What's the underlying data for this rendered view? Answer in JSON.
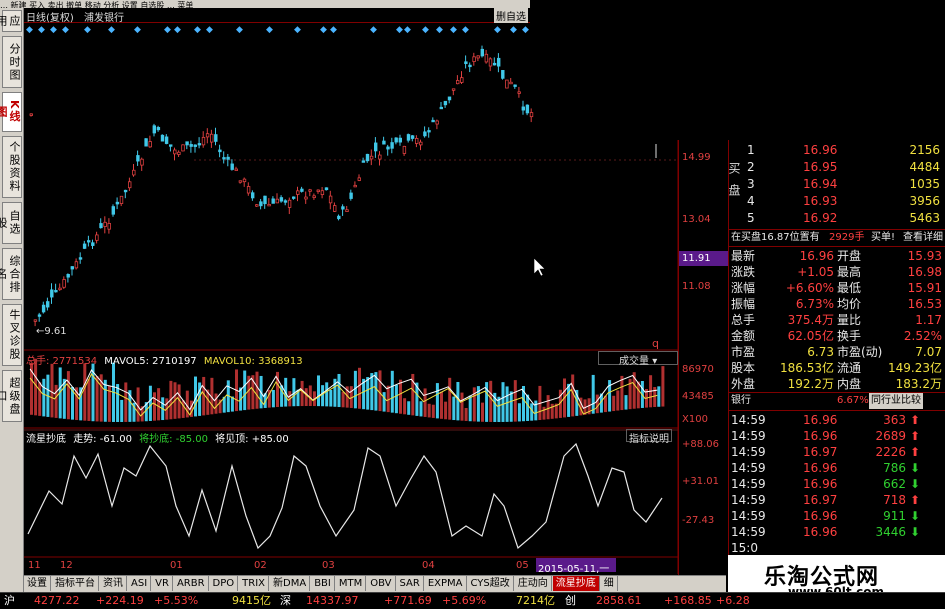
{
  "top_menu": {
    "text": "…  新建  买入  卖出  撤单  移动  分析  设置  自选股  …  菜单"
  },
  "left_tabs": [
    {
      "label": "应用",
      "active": false
    },
    {
      "label": "分时图",
      "active": false
    },
    {
      "label": "K线图",
      "active": true
    },
    {
      "label": "个股资料",
      "active": false
    },
    {
      "label": "自选股",
      "active": false
    },
    {
      "label": "综合排名",
      "active": false
    },
    {
      "label": "牛叉诊股",
      "active": false
    },
    {
      "label": "超级盘口",
      "active": false
    }
  ],
  "title": {
    "period": "日线(复权)",
    "stock": "浦发银行",
    "add_watch": "删自选"
  },
  "price_axis": {
    "labels": [
      "14.99",
      "13.04",
      "11.91",
      "11.08"
    ],
    "low_label": "9.61",
    "arrow_label": "q"
  },
  "volume_panel": {
    "total_label": "总手: 2771534",
    "ma5_label": "MAVOL5: 2710197",
    "ma10_label": "MAVOL10: 3368913",
    "selector": "成交量",
    "axis": [
      "86970",
      "43485",
      "X100"
    ]
  },
  "indicator_panel": {
    "name": "流星抄底",
    "trend": "走势: -61.00",
    "buy": "将抄底: -85.00",
    "sell": "将见顶: +85.00",
    "help": "指标说明",
    "axis": [
      "+88.06",
      "+31.01",
      "-27.43"
    ]
  },
  "date_axis": {
    "labels": [
      "11",
      "12",
      "01",
      "02",
      "03",
      "04",
      "05"
    ],
    "cursor_date": "2015-05-11,一"
  },
  "bottom_tabs": [
    "设置",
    "指标平台",
    "资讯",
    "ASI",
    "VR",
    "ARBR",
    "DPO",
    "TRIX",
    "新DMA",
    "BBI",
    "MTM",
    "OBV",
    "SAR",
    "EXPMA",
    "CYS超改",
    "庄动向",
    "流星抄底",
    "细"
  ],
  "bottom_active": "流星抄底",
  "order_book": {
    "sell_label": "买盘",
    "rows": [
      {
        "n": "1",
        "p": "16.96",
        "v": "2156"
      },
      {
        "n": "2",
        "p": "16.95",
        "v": "4484"
      },
      {
        "n": "3",
        "p": "16.94",
        "v": "1035"
      },
      {
        "n": "4",
        "p": "16.93",
        "v": "3956"
      },
      {
        "n": "5",
        "p": "16.92",
        "v": "5463"
      }
    ]
  },
  "order_info": {
    "text": "在买盘16.87位置有",
    "qty": "2929手",
    "action": "买单!",
    "detail": "查看详细"
  },
  "stats": [
    {
      "k1": "最新",
      "v1": "16.96",
      "k2": "开盘",
      "v2": "15.93"
    },
    {
      "k1": "涨跌",
      "v1": "+1.05",
      "k2": "最高",
      "v2": "16.98"
    },
    {
      "k1": "涨幅",
      "v1": "+6.60%",
      "k2": "最低",
      "v2": "15.91"
    },
    {
      "k1": "振幅",
      "v1": "6.73%",
      "k2": "均价",
      "v2": "16.53"
    },
    {
      "k1": "总手",
      "v1": "375.4万",
      "k2": "量比",
      "v2": "1.17"
    },
    {
      "k1": "金额",
      "v1": "62.05亿",
      "k2": "换手",
      "v2": "2.52%"
    },
    {
      "k1": "市盈",
      "v1": "6.73",
      "k2": "市盈(动)",
      "v2": "7.07"
    },
    {
      "k1": "股本",
      "v1": "186.53亿",
      "k2": "流通",
      "v2": "149.23亿"
    },
    {
      "k1": "外盘",
      "v1": "192.2万",
      "k2": "内盘",
      "v2": "183.2万"
    }
  ],
  "industry": {
    "name": "银行",
    "pct": "6.67%",
    "compare": "同行业比较"
  },
  "ticks": [
    {
      "t": "14:59",
      "p": "16.96",
      "v": "363",
      "dir": "up"
    },
    {
      "t": "14:59",
      "p": "16.96",
      "v": "2689",
      "dir": "up"
    },
    {
      "t": "14:59",
      "p": "16.97",
      "v": "2226",
      "dir": "up"
    },
    {
      "t": "14:59",
      "p": "16.96",
      "v": "786",
      "dir": "down"
    },
    {
      "t": "14:59",
      "p": "16.96",
      "v": "662",
      "dir": "down"
    },
    {
      "t": "14:59",
      "p": "16.97",
      "v": "718",
      "dir": "up"
    },
    {
      "t": "14:59",
      "p": "16.96",
      "v": "911",
      "dir": "down"
    },
    {
      "t": "14:59",
      "p": "16.96",
      "v": "3446",
      "dir": "down"
    },
    {
      "t": "15:0",
      "p": "",
      "v": "",
      "dir": ""
    }
  ],
  "statusbar": {
    "sh_label": "沪",
    "sh_index": "4277.22",
    "sh_chg": "+224.19",
    "sh_pct": "+5.53%",
    "sh_amt": "9415亿",
    "sz_label": "深",
    "sz_index": "14337.97",
    "sz_chg": "+771.69",
    "sz_pct": "+5.69%",
    "sz_amt": "7214亿",
    "cy_label": "创",
    "cy_index": "2858.61",
    "cy_chg": "+168.85",
    "cy_pct": "+6.28"
  },
  "watermark": {
    "title": "乐淘公式网",
    "url": "www.60lt.com"
  },
  "colors": {
    "up": "#e04040",
    "down": "#40c8e8",
    "axis": "#800000",
    "line": "#e8e8e8",
    "ma_white": "#ffffff",
    "ma_yellow": "#f0e040"
  }
}
